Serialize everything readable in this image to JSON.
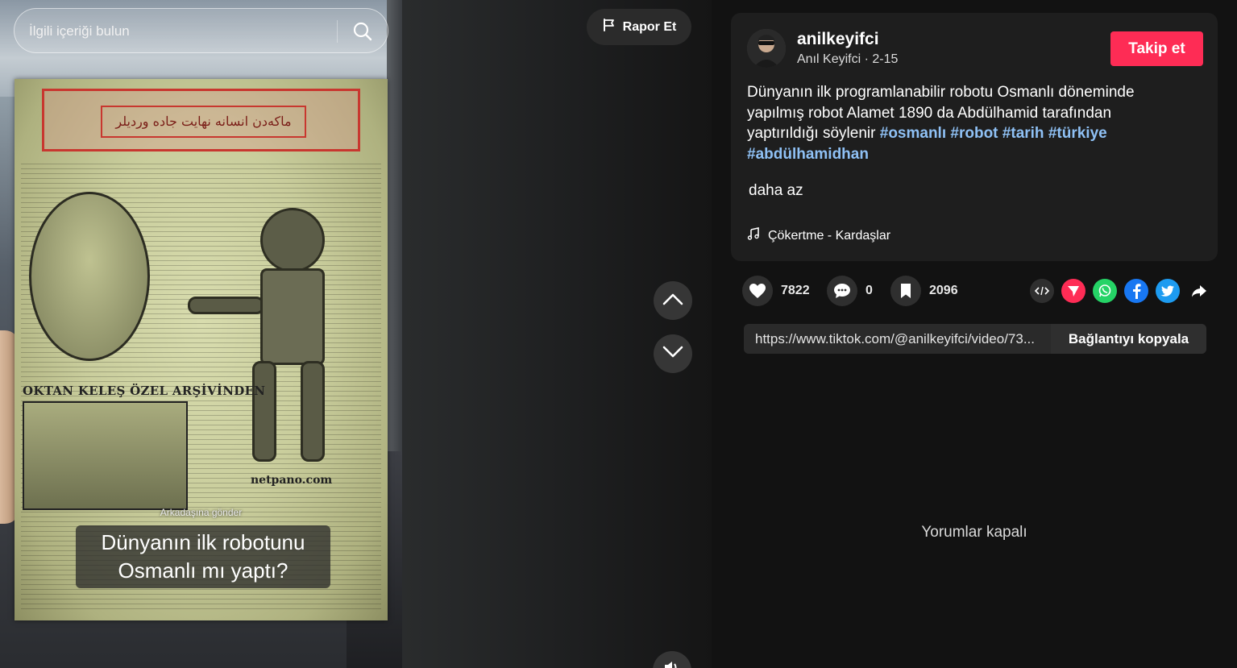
{
  "search": {
    "placeholder": "İlgili içeriği bulun"
  },
  "video": {
    "report_label": "Rapor Et",
    "send_to_friend": "Arkadaşına gönder",
    "caption_line1": "Dünyanın ilk robotunu",
    "caption_line2": "Osmanlı mı yaptı?",
    "newspaper_header": "ماكەدن انسانه نهايت جاده وردیلر",
    "newspaper_archive": "OKTAN KELEŞ ÖZEL ARŞİVİNDEN",
    "newspaper_site": "netpano.com"
  },
  "author": {
    "username": "anilkeyifci",
    "display_name": "Anıl Keyifci",
    "date": "2-15",
    "follow_label": "Takip et"
  },
  "post": {
    "description_text": "Dünyanın ilk programlanabilir robotu Osmanlı döneminde yapılmış robot Alamet 1890 da Abdülhamid tarafından yaptırıldığı söylenir",
    "hashtags": [
      "#osmanlı",
      "#robot",
      "#tarih",
      "#türkiye",
      "#abdülhamidhan"
    ],
    "less_label": "daha az",
    "music": "Çökertme - Kardaşlar"
  },
  "stats": {
    "likes": "7822",
    "comments": "0",
    "saves": "2096"
  },
  "share": {
    "icons": [
      "embed-icon",
      "send-to-friend-icon",
      "whatsapp-icon",
      "facebook-icon",
      "twitter-icon",
      "share-arrow-icon"
    ],
    "colors": {
      "send": "#fe2c55",
      "whatsapp": "#25d366",
      "facebook": "#1877f2",
      "twitter": "#1d9bf0"
    }
  },
  "link": {
    "url": "https://www.tiktok.com/@anilkeyifci/video/73...",
    "copy_label": "Bağlantıyı kopyala"
  },
  "comments": {
    "disabled_text": "Yorumlar kapalı"
  },
  "colors": {
    "accent": "#fe2c55",
    "hashtag": "#8fc1f5",
    "background": "#121212",
    "card": "#1e1e1e"
  }
}
